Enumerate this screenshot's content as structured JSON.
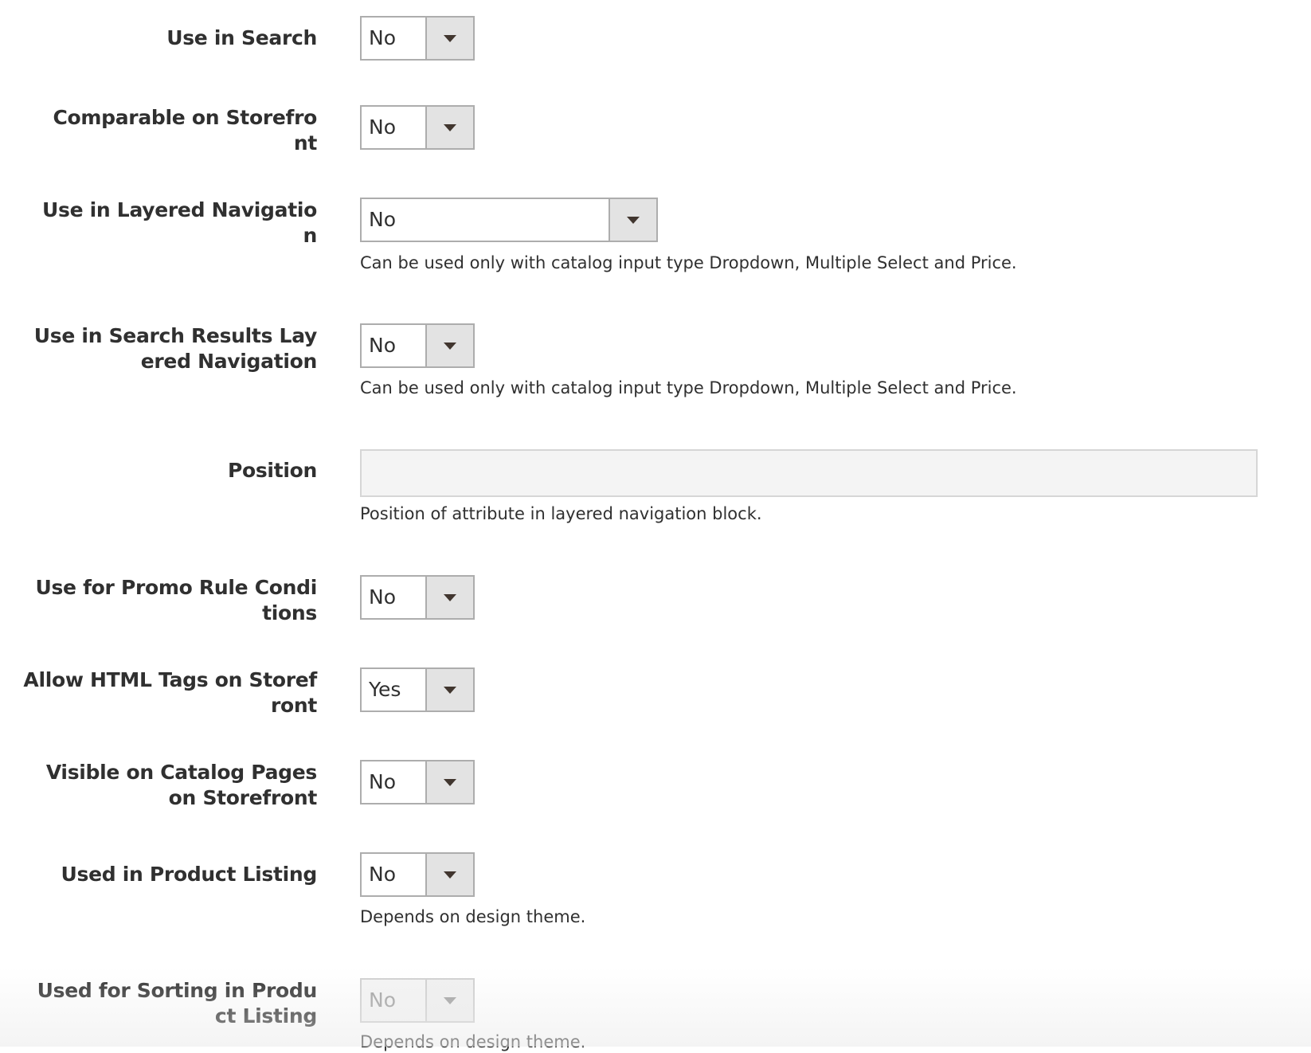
{
  "fields": {
    "use_in_search": {
      "label_lines": [
        "Use in Search"
      ],
      "value": "No"
    },
    "comparable_on_storefront": {
      "label_lines": [
        "Comparable on Storefro",
        "nt"
      ],
      "value": "No"
    },
    "use_in_layered_navigation": {
      "label_lines": [
        "Use in Layered Navigatio",
        "n"
      ],
      "value": "No",
      "note": "Can be used only with catalog input type Dropdown, Multiple Select and Price."
    },
    "use_in_search_results_layered_navigation": {
      "label_lines": [
        "Use in Search Results Lay",
        "ered Navigation"
      ],
      "value": "No",
      "note": "Can be used only with catalog input type Dropdown, Multiple Select and Price."
    },
    "position": {
      "label_lines": [
        "Position"
      ],
      "value": "",
      "note": "Position of attribute in layered navigation block."
    },
    "use_for_promo_rule_conditions": {
      "label_lines": [
        "Use for Promo Rule Condi",
        "tions"
      ],
      "value": "No"
    },
    "allow_html_tags_on_storefront": {
      "label_lines": [
        "Allow HTML Tags on Storef",
        "ront"
      ],
      "value": "Yes"
    },
    "visible_on_catalog_pages_on_storefront": {
      "label_lines": [
        "Visible on Catalog Pages",
        "on Storefront"
      ],
      "value": "No"
    },
    "used_in_product_listing": {
      "label_lines": [
        "Used in Product Listing"
      ],
      "value": "No",
      "note": "Depends on design theme."
    },
    "used_for_sorting_in_product_listing": {
      "label_lines": [
        "Used for Sorting in Produ",
        "ct Listing"
      ],
      "value": "No",
      "disabled": true,
      "note": "Depends on design theme."
    }
  },
  "icons": {
    "select_arrow": "triangle-down"
  },
  "colors": {
    "label_text": "#303030",
    "select_border": "#adadad",
    "select_arrow_bg": "#e3e3e3",
    "disabled_text": "#a0a0a0",
    "input_bg": "#f4f4f4"
  }
}
